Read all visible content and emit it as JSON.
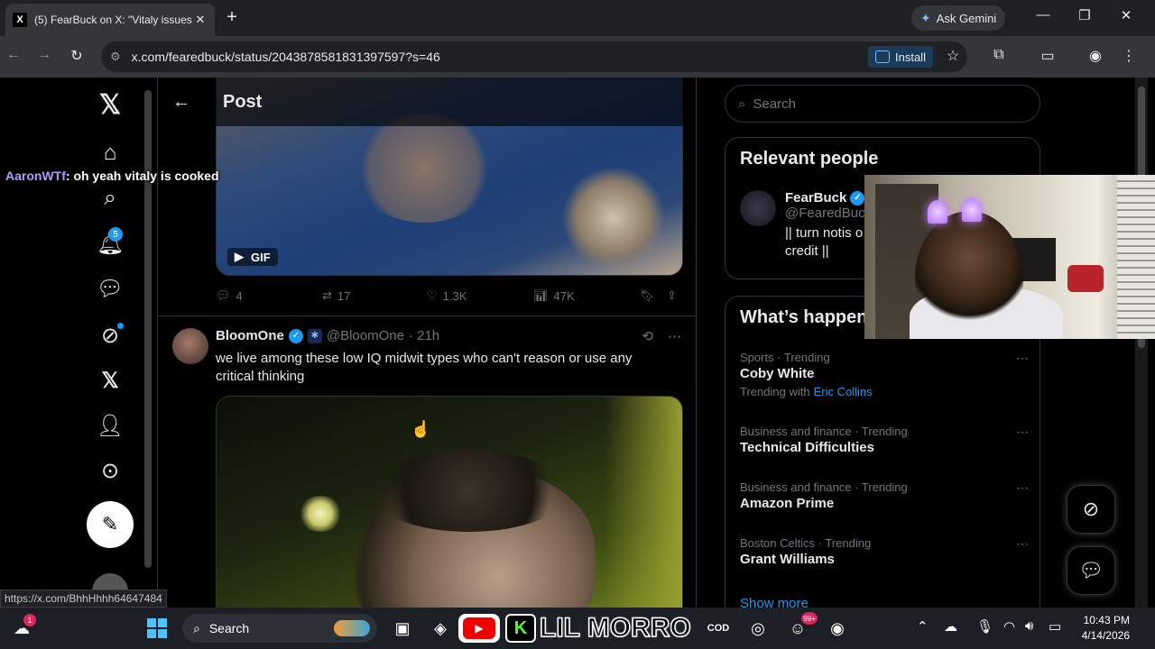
{
  "browser": {
    "tab_title": "(5) FearBuck on X: \"Vitaly issues",
    "tab_favicon": "X",
    "new_tab": "+",
    "ask_gemini": "Ask Gemini",
    "url": "x.com/fearedbuck/status/2043878581831397597?s=46",
    "install_label": "Install",
    "status_link": "https://x.com/BhhHhhh64647484"
  },
  "stream_chat": {
    "user": "AaronWTf",
    "message": ": oh yeah vitaly is cooked"
  },
  "nav": {
    "notification_count": "5"
  },
  "header": {
    "title": "Post",
    "back_icon": "←"
  },
  "post1": {
    "gif_label": "GIF",
    "replies": "4",
    "reposts": "17",
    "likes": "1.3K",
    "views": "47K"
  },
  "post2": {
    "name": "BloomOne",
    "handle": "@BloomOne",
    "time": "· 21h",
    "text": "we live among these low IQ midwit types who can't reason or use any critical thinking"
  },
  "sidebar": {
    "search_placeholder": "Search",
    "relevant_title": "Relevant people",
    "person_name": "FearBuck",
    "person_handle": "@FearedBuck",
    "person_bio_1": "|| turn notis o",
    "person_bio_2": "credit ||",
    "whats_happening": "What’s happen",
    "trends": [
      {
        "meta": "Sports · Trending",
        "topic": "Coby White",
        "with_label": "Trending with",
        "with_link": "Eric Collins"
      },
      {
        "meta": "Business and finance · Trending",
        "topic": "Technical Difficulties"
      },
      {
        "meta": "Business and finance · Trending",
        "topic": "Amazon Prime"
      },
      {
        "meta": "Boston Celtics · Trending",
        "topic": "Grant Williams"
      }
    ],
    "show_more": "Show more"
  },
  "taskbar": {
    "search_label": "Search",
    "kick_letter": "K",
    "overlay_text": "LIL MORRO",
    "time": "10:43 PM",
    "date": "4/14/2026",
    "weather_badge": "1",
    "discord_badge": "99+"
  },
  "colors": {
    "accent": "#1d9bf0",
    "chat_user": "#b497ff",
    "background": "#000000"
  }
}
